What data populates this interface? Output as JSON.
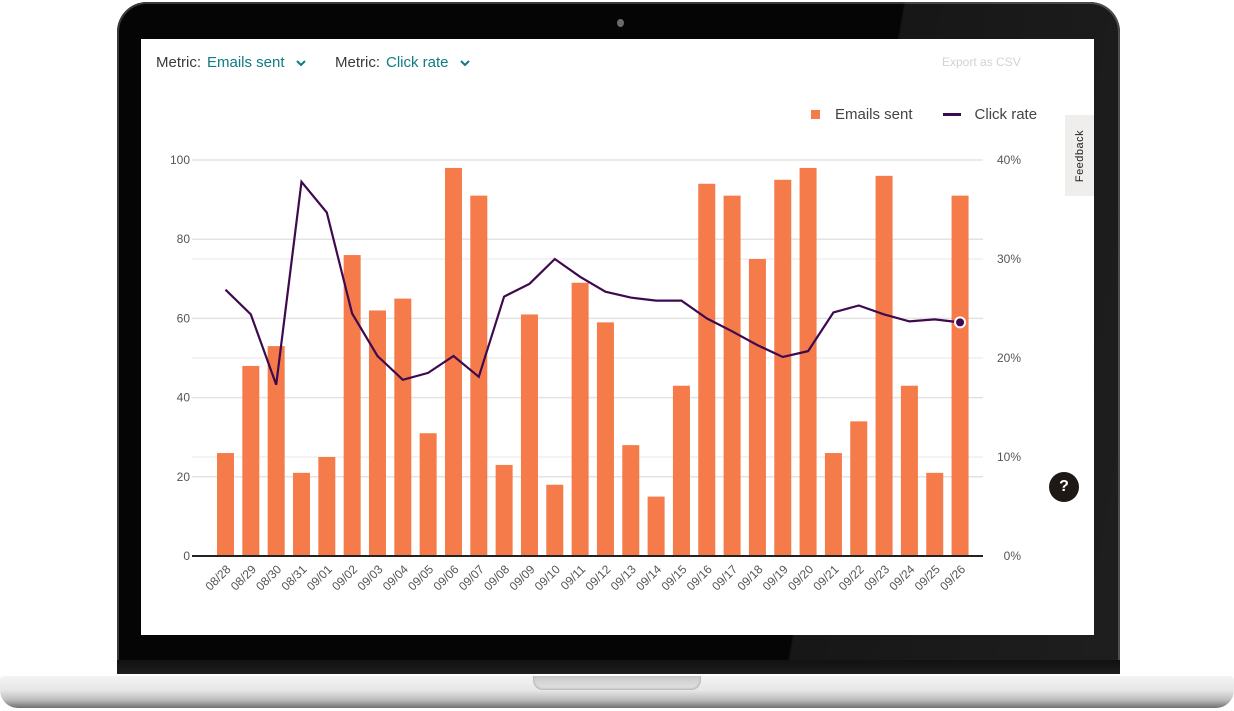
{
  "header": {
    "metric1_label": "Metric:",
    "metric1_value": "Emails sent",
    "metric2_label": "Metric:",
    "metric2_value": "Click rate",
    "export_label": "Export as CSV"
  },
  "feedback_label": "Feedback",
  "help_label": "?",
  "colors": {
    "bar": "#f67b4a",
    "line": "#3e0a4f",
    "accent": "#0f7c83"
  },
  "chart_data": {
    "type": "bar",
    "title": "",
    "xlabel": "",
    "ylabel": "Emails sent",
    "y2label": "Click rate",
    "ylim": [
      0,
      100
    ],
    "y2lim": [
      0,
      40
    ],
    "yticks": [
      "0",
      "20",
      "40",
      "60",
      "80",
      "100"
    ],
    "y2ticks": [
      "0%",
      "10%",
      "20%",
      "30%",
      "40%"
    ],
    "grid": true,
    "legend": {
      "placement": "top-right",
      "entries": [
        "Emails sent",
        "Click rate"
      ]
    },
    "categories": [
      "08/28",
      "08/29",
      "08/30",
      "08/31",
      "09/01",
      "09/02",
      "09/03",
      "09/04",
      "09/05",
      "09/06",
      "09/07",
      "09/08",
      "09/09",
      "09/10",
      "09/11",
      "09/12",
      "09/13",
      "09/14",
      "09/15",
      "09/16",
      "09/17",
      "09/18",
      "09/19",
      "09/20",
      "09/21",
      "09/22",
      "09/23",
      "09/24",
      "09/25",
      "09/26"
    ],
    "series": [
      {
        "name": "Emails sent",
        "type": "bar",
        "axis": "left",
        "values": [
          26,
          48,
          53,
          21,
          25,
          76,
          62,
          65,
          31,
          98,
          91,
          23,
          61,
          18,
          69,
          59,
          28,
          15,
          43,
          94,
          91,
          75,
          95,
          98,
          26,
          34,
          96,
          43,
          21,
          91
        ]
      },
      {
        "name": "Click rate",
        "type": "line",
        "axis": "right",
        "unit": "%",
        "values": [
          26.9,
          24.4,
          17.3,
          37.8,
          34.7,
          24.5,
          20.2,
          17.8,
          18.5,
          20.2,
          18.1,
          26.2,
          27.5,
          30.0,
          28.2,
          26.7,
          26.1,
          25.8,
          25.8,
          24.0,
          22.7,
          21.3,
          20.1,
          20.7,
          24.6,
          25.3,
          24.4,
          23.7,
          23.9,
          23.6
        ],
        "highlighted_point": "09/26"
      }
    ]
  }
}
